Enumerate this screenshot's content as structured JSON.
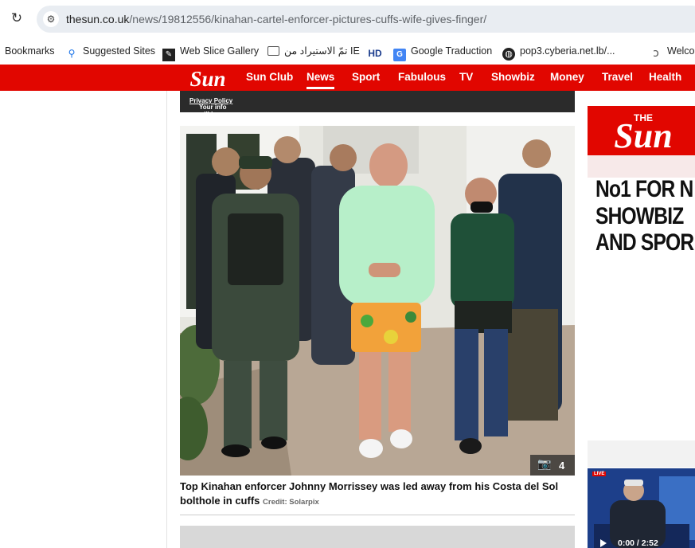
{
  "browser": {
    "url_host": "thesun.co.uk",
    "url_path": "/news/19812556/kinahan-cartel-enforcer-pictures-cuffs-wife-gives-finger/"
  },
  "bookmarks": [
    {
      "label": "Bookmarks",
      "icon": "none"
    },
    {
      "label": "Suggested Sites",
      "icon": "search-icon"
    },
    {
      "label": "Web Slice Gallery",
      "icon": "web-slice-icon"
    },
    {
      "label": "تمّ الاستيراد من IE",
      "icon": "folder-icon"
    },
    {
      "label": "",
      "icon": "hd-icon"
    },
    {
      "label": "Google Traduction",
      "icon": "google-translate-icon"
    },
    {
      "label": "pop3.cyberia.net.lb/...",
      "icon": "globe-icon"
    },
    {
      "label": "Welco",
      "icon": "hook-icon"
    }
  ],
  "hd_label": "HD",
  "nav": {
    "logo_text": "Sun",
    "items": [
      "Sun Club",
      "News",
      "Sport",
      "Fabulous",
      "TV",
      "Showbiz",
      "Money",
      "Travel",
      "Health"
    ],
    "active": "News"
  },
  "info_strip": {
    "text": "Your info will be used in accordance with our ",
    "link": "Privacy Policy"
  },
  "article": {
    "gallery_count": "4",
    "caption": "Top Kinahan enforcer Johnny Morrissey was led away from his Costa del Sol bolthole in cuffs",
    "credit": "Credit: Solarpix"
  },
  "ad": {
    "logo_small": "THE",
    "logo": "Sun",
    "lines": [
      "No1 FOR N",
      "SHOWBIZ",
      "AND SPOR"
    ]
  },
  "video": {
    "live_label": "LIVE",
    "time": "0:00 / 2:52"
  },
  "colors": {
    "brand_red": "#e10600",
    "strip_dark": "#2b2b2b"
  }
}
